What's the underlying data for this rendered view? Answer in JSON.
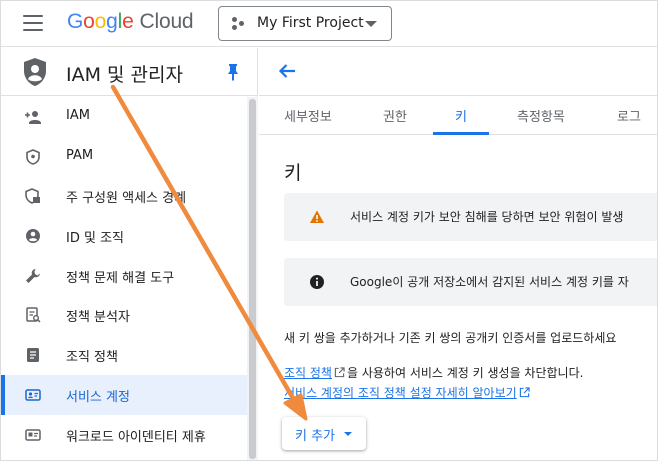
{
  "header": {
    "logo_google": "Google",
    "logo_cloud": "Cloud",
    "project_name": "My First Project"
  },
  "sidebar": {
    "title": "IAM 및 관리자",
    "items": [
      {
        "label": "IAM",
        "icon": "add-person-icon"
      },
      {
        "label": "PAM",
        "icon": "shield-small-icon"
      },
      {
        "label": "주 구성원 액세스 경계",
        "icon": "shield-lock-icon"
      },
      {
        "label": "ID 및 조직",
        "icon": "account-circle-icon"
      },
      {
        "label": "정책 문제 해결 도구",
        "icon": "wrench-icon"
      },
      {
        "label": "정책 분석자",
        "icon": "policy-analyzer-icon"
      },
      {
        "label": "조직 정책",
        "icon": "document-icon"
      },
      {
        "label": "서비스 계정",
        "icon": "service-account-icon",
        "active": true
      },
      {
        "label": "워크로드 아이덴티티 제휴",
        "icon": "id-card-icon"
      }
    ]
  },
  "tabs": [
    {
      "label": "세부정보"
    },
    {
      "label": "권한"
    },
    {
      "label": "키",
      "active": true
    },
    {
      "label": "측정항목"
    },
    {
      "label": "로그"
    }
  ],
  "main": {
    "section_title": "키",
    "warning_banner": "서비스 계정 키가 보안 침해를 당하면 보안 위험이 발생",
    "info_banner": "Google이 공개 저장소에서 감지된 서비스 계정 키를 자",
    "para1": "새 키 쌍을 추가하거나 기존 키 쌍의 공개키 인증서를 업로드하세요",
    "para2_link": "조직 정책",
    "para2_rest": "을 사용하여 서비스 계정 키 생성을 차단합니다.",
    "para3_link": "서비스 계정의 조직 정책 설정 자세히 알아보기",
    "add_key_label": "키 추가"
  },
  "colors": {
    "accent": "#1a73e8",
    "annotation_arrow": "#f08a3c",
    "warning": "#e37400"
  }
}
